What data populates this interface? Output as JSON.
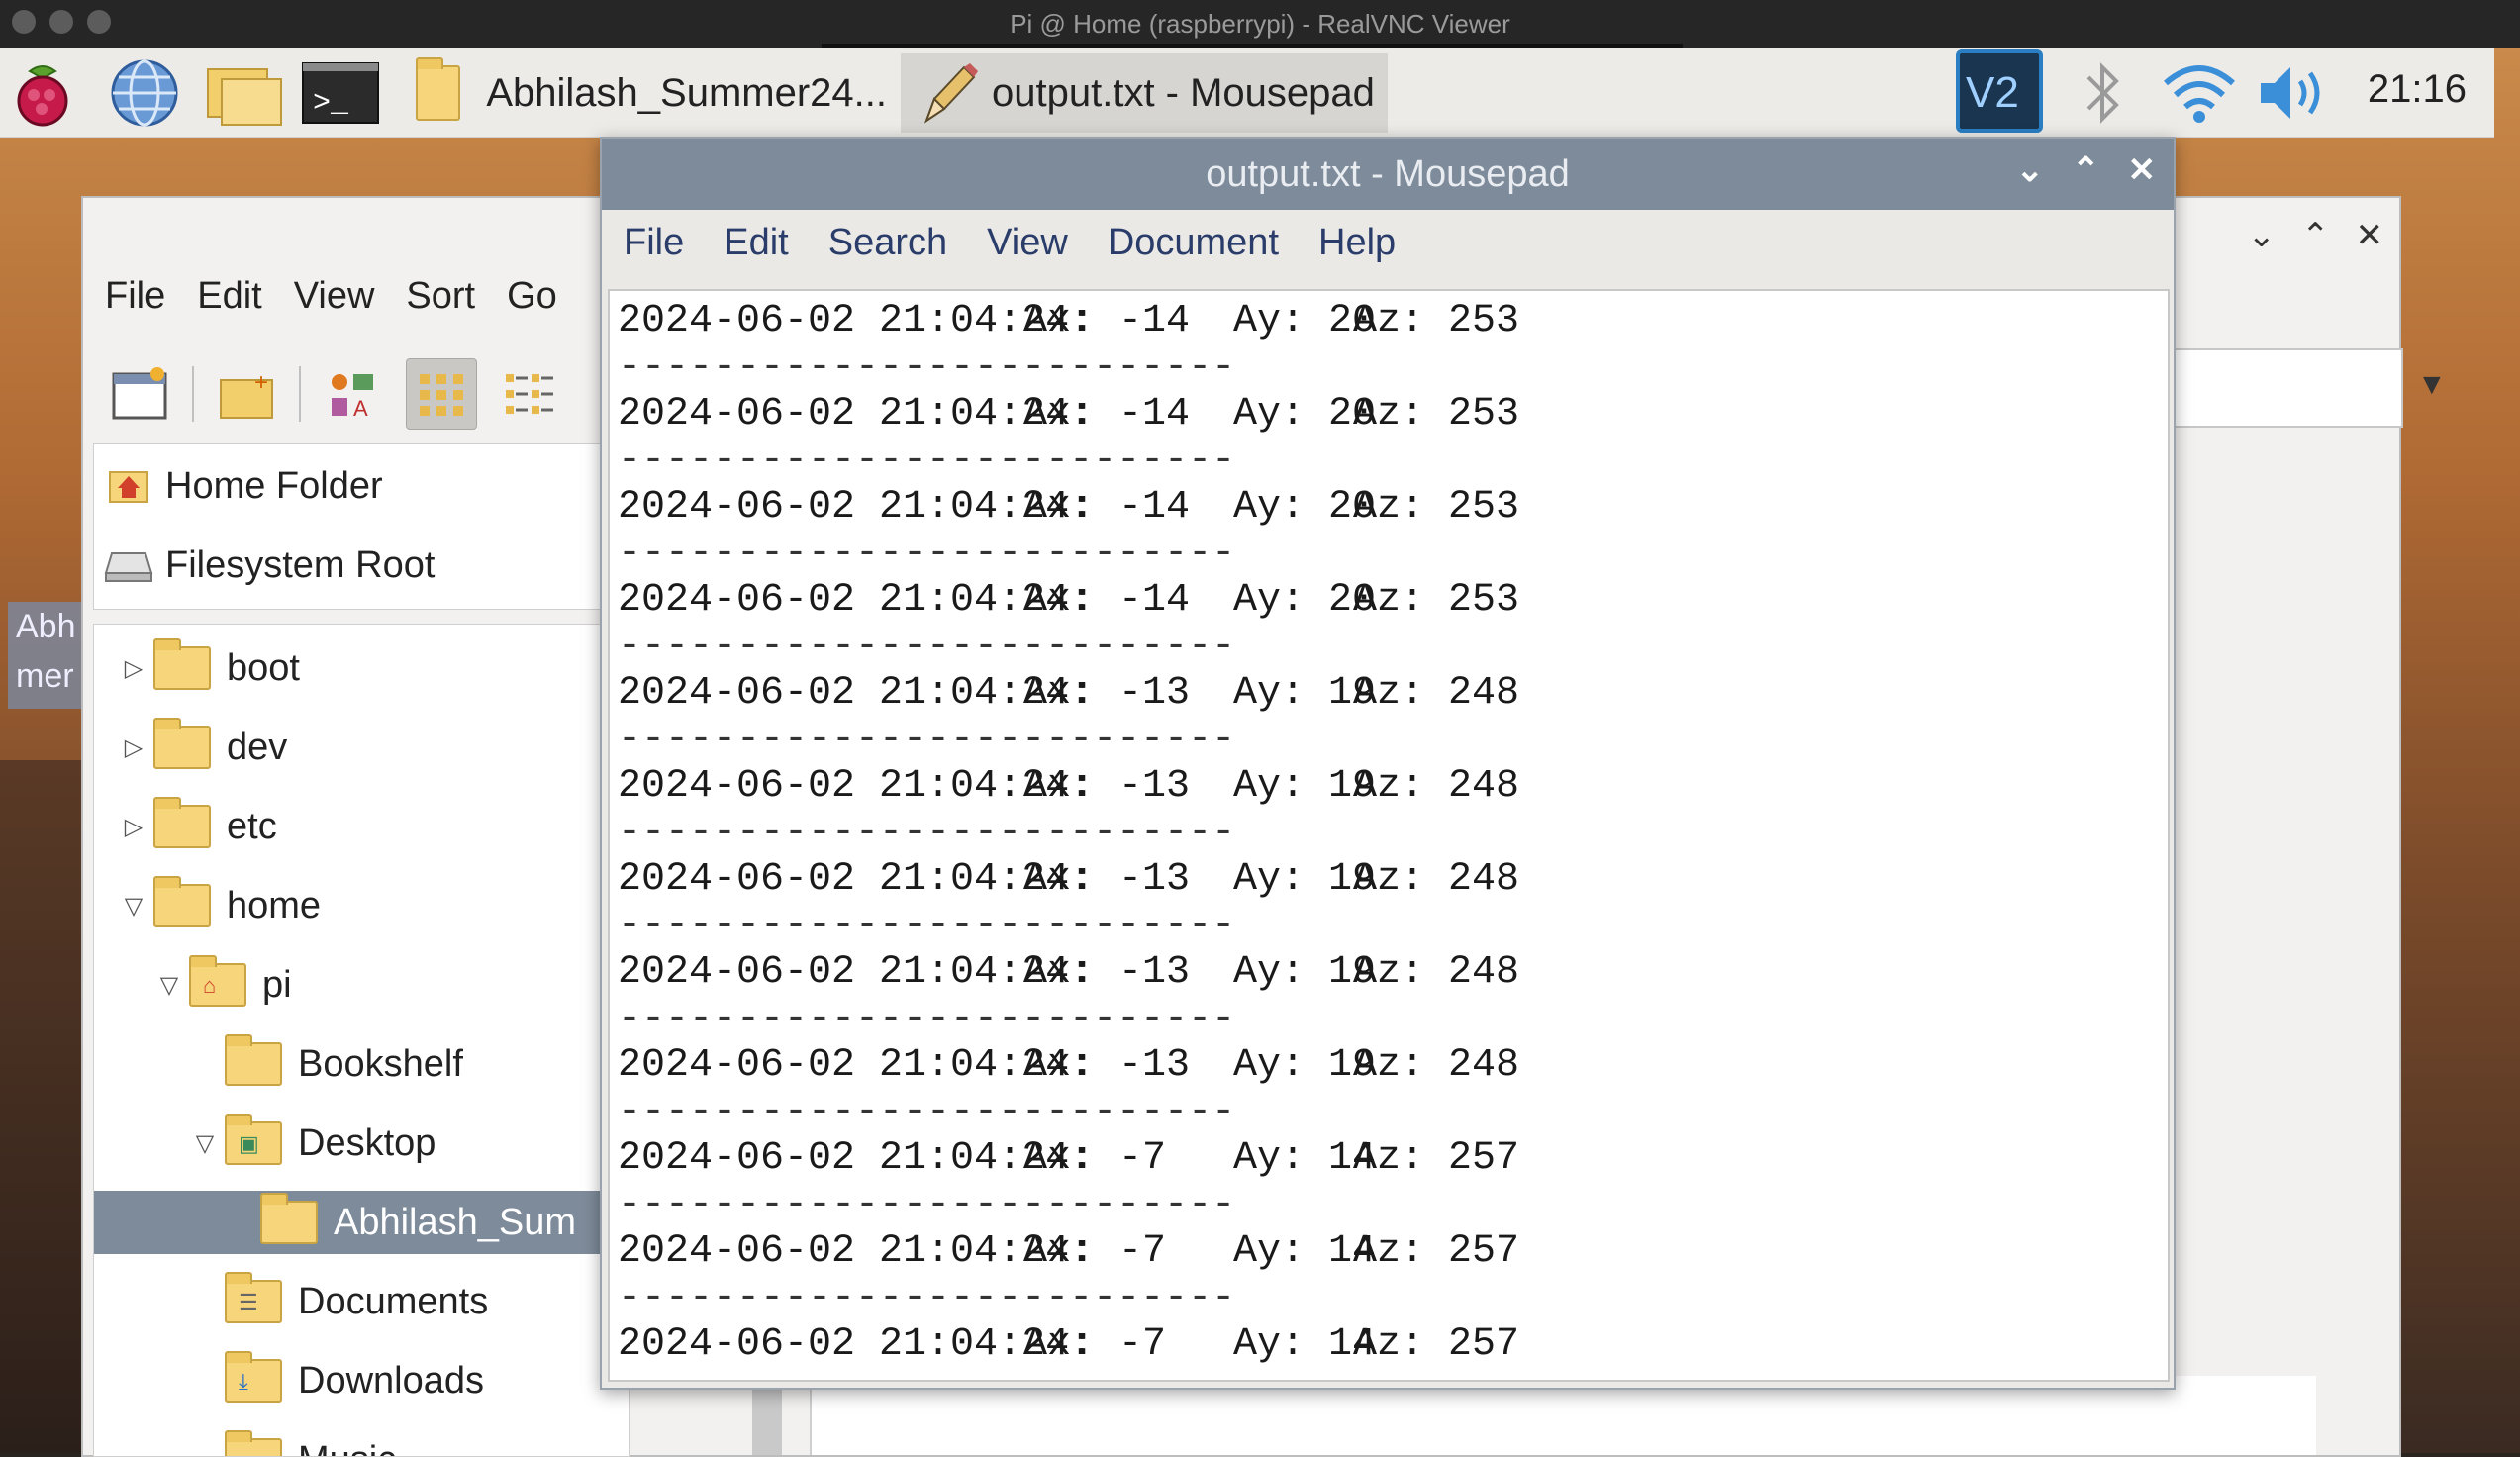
{
  "mac": {
    "window_title": "Pi @ Home (raspberrypi) - RealVNC Viewer"
  },
  "taskbar": {
    "icons": [
      "raspberry-menu-icon",
      "web-browser-icon",
      "file-manager-icon",
      "terminal-icon"
    ],
    "tasks": [
      {
        "label": "Abhilash_Summer24...",
        "icon": "folder-icon",
        "active": false
      },
      {
        "label": "output.txt - Mousepad",
        "icon": "pencil-icon",
        "active": true
      }
    ],
    "tray": [
      "vnc-icon",
      "bluetooth-icon",
      "wifi-icon",
      "volume-icon"
    ],
    "clock": "21:16"
  },
  "desktop": {
    "icon_label": "Abh mer"
  },
  "file_manager": {
    "menu": [
      "File",
      "Edit",
      "View",
      "Sort",
      "Go"
    ],
    "places": [
      "Home Folder",
      "Filesystem Root"
    ],
    "tree": [
      {
        "label": "boot",
        "expander": "collapsed",
        "icon": "folder"
      },
      {
        "label": "dev",
        "expander": "collapsed",
        "icon": "folder"
      },
      {
        "label": "etc",
        "expander": "collapsed",
        "icon": "folder"
      },
      {
        "label": "home",
        "expander": "expanded",
        "icon": "folder"
      },
      {
        "label": "pi",
        "expander": "expanded",
        "icon": "home-folder"
      },
      {
        "label": "Bookshelf",
        "expander": "none",
        "icon": "folder"
      },
      {
        "label": "Desktop",
        "expander": "expanded",
        "icon": "desktop-folder"
      },
      {
        "label": "Abhilash_Sum",
        "expander": "none",
        "icon": "folder",
        "selected": true
      },
      {
        "label": "Documents",
        "expander": "none",
        "icon": "documents-folder"
      },
      {
        "label": "Downloads",
        "expander": "none",
        "icon": "downloads-folder"
      },
      {
        "label": "Music",
        "expander": "none",
        "icon": "music-folder"
      }
    ]
  },
  "mousepad": {
    "title": "output.txt - Mousepad",
    "menu": [
      "File",
      "Edit",
      "Search",
      "View",
      "Document",
      "Help"
    ],
    "separator": "--------------------------",
    "rows": [
      {
        "ts": "2024-06-02 21:04:24:",
        "ax": "Ax: -14",
        "ay": "Ay: 20",
        "az": "Az: 253"
      },
      {
        "ts": "2024-06-02 21:04:24:",
        "ax": "Ax: -14",
        "ay": "Ay: 20",
        "az": "Az: 253"
      },
      {
        "ts": "2024-06-02 21:04:24:",
        "ax": "Ax: -14",
        "ay": "Ay: 20",
        "az": "Az: 253"
      },
      {
        "ts": "2024-06-02 21:04:24:",
        "ax": "Ax: -14",
        "ay": "Ay: 20",
        "az": "Az: 253"
      },
      {
        "ts": "2024-06-02 21:04:24:",
        "ax": "Ax: -13",
        "ay": "Ay: 19",
        "az": "Az: 248"
      },
      {
        "ts": "2024-06-02 21:04:24:",
        "ax": "Ax: -13",
        "ay": "Ay: 19",
        "az": "Az: 248"
      },
      {
        "ts": "2024-06-02 21:04:24:",
        "ax": "Ax: -13",
        "ay": "Ay: 19",
        "az": "Az: 248"
      },
      {
        "ts": "2024-06-02 21:04:24:",
        "ax": "Ax: -13",
        "ay": "Ay: 19",
        "az": "Az: 248"
      },
      {
        "ts": "2024-06-02 21:04:24:",
        "ax": "Ax: -13",
        "ay": "Ay: 19",
        "az": "Az: 248"
      },
      {
        "ts": "2024-06-02 21:04:24:",
        "ax": "Ax: -7",
        "ay": "Ay: 14",
        "az": "Az: 257"
      },
      {
        "ts": "2024-06-02 21:04:24:",
        "ax": "Ax: -7",
        "ay": "Ay: 14",
        "az": "Az: 257"
      },
      {
        "ts": "2024-06-02 21:04:24:",
        "ax": "Ax: -7",
        "ay": "Ay: 14",
        "az": "Az: 257"
      }
    ]
  }
}
